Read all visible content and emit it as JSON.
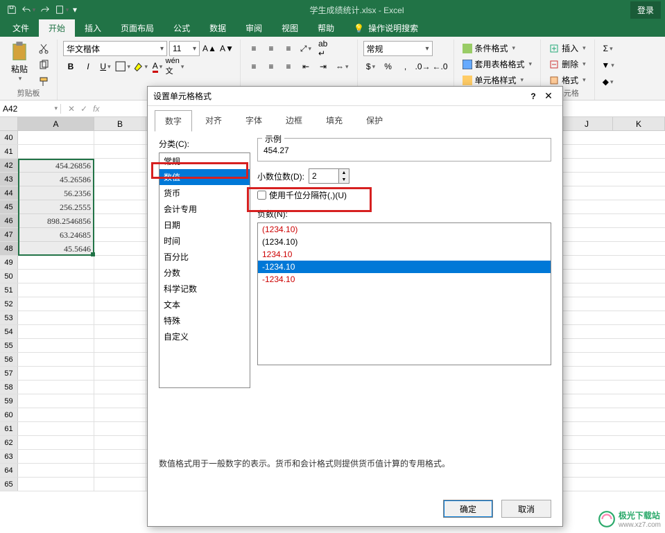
{
  "title": "学生成绩统计.xlsx - Excel",
  "login": "登录",
  "tabs": [
    "文件",
    "开始",
    "插入",
    "页面布局",
    "公式",
    "数据",
    "审阅",
    "视图",
    "帮助"
  ],
  "tell_me": "操作说明搜索",
  "ribbon": {
    "clipboard_label": "剪贴板",
    "paste": "粘贴",
    "font_name": "华文楷体",
    "font_size": "11",
    "number_format": "常规",
    "cond_fmt": "条件格式",
    "table_fmt": "套用表格格式",
    "cell_fmt": "单元格样式",
    "insert": "插入",
    "delete": "删除",
    "format": "格式",
    "cells_label": "单元格"
  },
  "namebox": "A42",
  "columns": [
    "A",
    "B",
    "J",
    "K"
  ],
  "rows_start": 40,
  "rows_end": 65,
  "data_cells": {
    "42": "454.26856",
    "43": "45.26586",
    "44": "56.2356",
    "45": "256.2555",
    "46": "898.2546856",
    "47": "63.24685",
    "48": "45.5646"
  },
  "dialog": {
    "title": "设置单元格格式",
    "tabs": [
      "数字",
      "对齐",
      "字体",
      "边框",
      "填充",
      "保护"
    ],
    "category_label": "分类(C):",
    "categories": [
      "常规",
      "数值",
      "货币",
      "会计专用",
      "日期",
      "时间",
      "百分比",
      "分数",
      "科学记数",
      "文本",
      "特殊",
      "自定义"
    ],
    "selected_category": 1,
    "sample_label": "示例",
    "sample_value": "454.27",
    "decimals_label": "小数位数(D):",
    "decimals_value": "2",
    "thousands_label": "使用千位分隔符(,)(U)",
    "negative_label": "负数(N):",
    "negatives": [
      "(1234.10)",
      "(1234.10)",
      "1234.10",
      "-1234.10",
      "-1234.10"
    ],
    "neg_selected": 3,
    "description": "数值格式用于一般数字的表示。货币和会计格式则提供货币值计算的专用格式。",
    "ok": "确定",
    "cancel": "取消"
  },
  "watermark": {
    "name": "极光下载站",
    "url": "www.xz7.com"
  }
}
